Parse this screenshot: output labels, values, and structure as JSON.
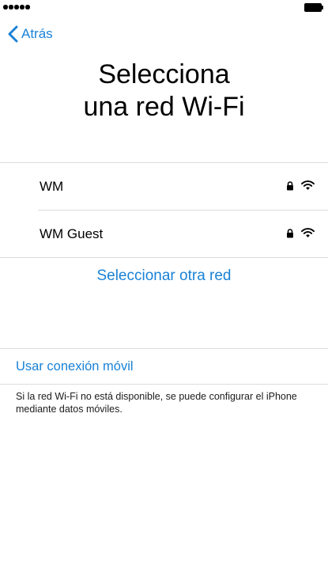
{
  "nav": {
    "back_label": "Atrás"
  },
  "header": {
    "title_line1": "Selecciona",
    "title_line2": "una red Wi-Fi"
  },
  "networks": [
    {
      "name": "WM",
      "secured": true,
      "icons": [
        "lock-icon",
        "wifi-icon"
      ]
    },
    {
      "name": "WM Guest",
      "secured": true,
      "icons": [
        "lock-icon",
        "wifi-icon"
      ]
    }
  ],
  "other_network_label": "Seleccionar otra red",
  "mobile": {
    "link_label": "Usar conexión móvil",
    "footnote": "Si la red Wi-Fi no está disponible, se puede configurar el iPhone mediante datos móviles."
  },
  "colors": {
    "accent": "#1a82d6",
    "divider": "#dcdcdc",
    "text": "#000000"
  }
}
